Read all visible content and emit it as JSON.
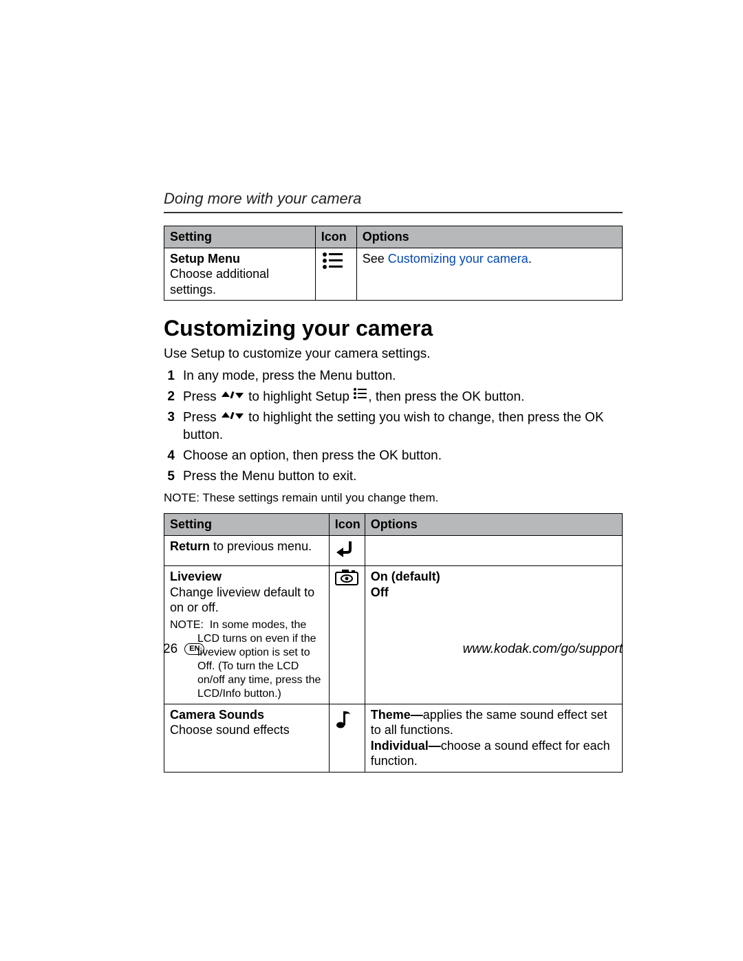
{
  "chapter": "Doing more with your camera",
  "table1": {
    "headers": [
      "Setting",
      "Icon",
      "Options"
    ],
    "row": {
      "title": "Setup Menu",
      "desc": "Choose additional settings.",
      "options_prefix": "See ",
      "options_link": "Customizing your camera",
      "options_suffix": "."
    }
  },
  "section_heading": "Customizing your camera",
  "intro": "Use Setup to customize your camera settings.",
  "steps": {
    "s1": "In any mode, press the Menu button.",
    "s2a": "Press ",
    "s2b": " to highlight Setup ",
    "s2c": ", then press the OK button.",
    "s3a": "Press ",
    "s3b": " to highlight the setting you wish to change, then press the OK button.",
    "s4": "Choose an option, then press the OK button.",
    "s5": "Press the Menu button to exit."
  },
  "note_line": "NOTE:  These settings remain until you change them.",
  "table2": {
    "headers": [
      "Setting",
      "Icon",
      "Options"
    ],
    "r1": {
      "bold": "Return",
      "rest": " to previous menu.",
      "options": ""
    },
    "r2": {
      "title": "Liveview",
      "desc": "Change liveview default to on or off.",
      "note_label": "NOTE:",
      "note_body": "In some modes, the LCD turns on even if the liveview option is set to Off. (To turn the LCD on/off any time, press the LCD/Info button.)",
      "opt_line1": "On (default)",
      "opt_line2": "Off"
    },
    "r3": {
      "title": "Camera Sounds",
      "desc": "Choose sound effects",
      "opt_theme_label": "Theme—",
      "opt_theme_rest": "applies the same sound effect set to all functions.",
      "opt_indiv_label": "Individual—",
      "opt_indiv_rest": "choose a sound effect for each function."
    }
  },
  "footer": {
    "page": "26",
    "lang": "EN",
    "url": "www.kodak.com/go/support"
  }
}
